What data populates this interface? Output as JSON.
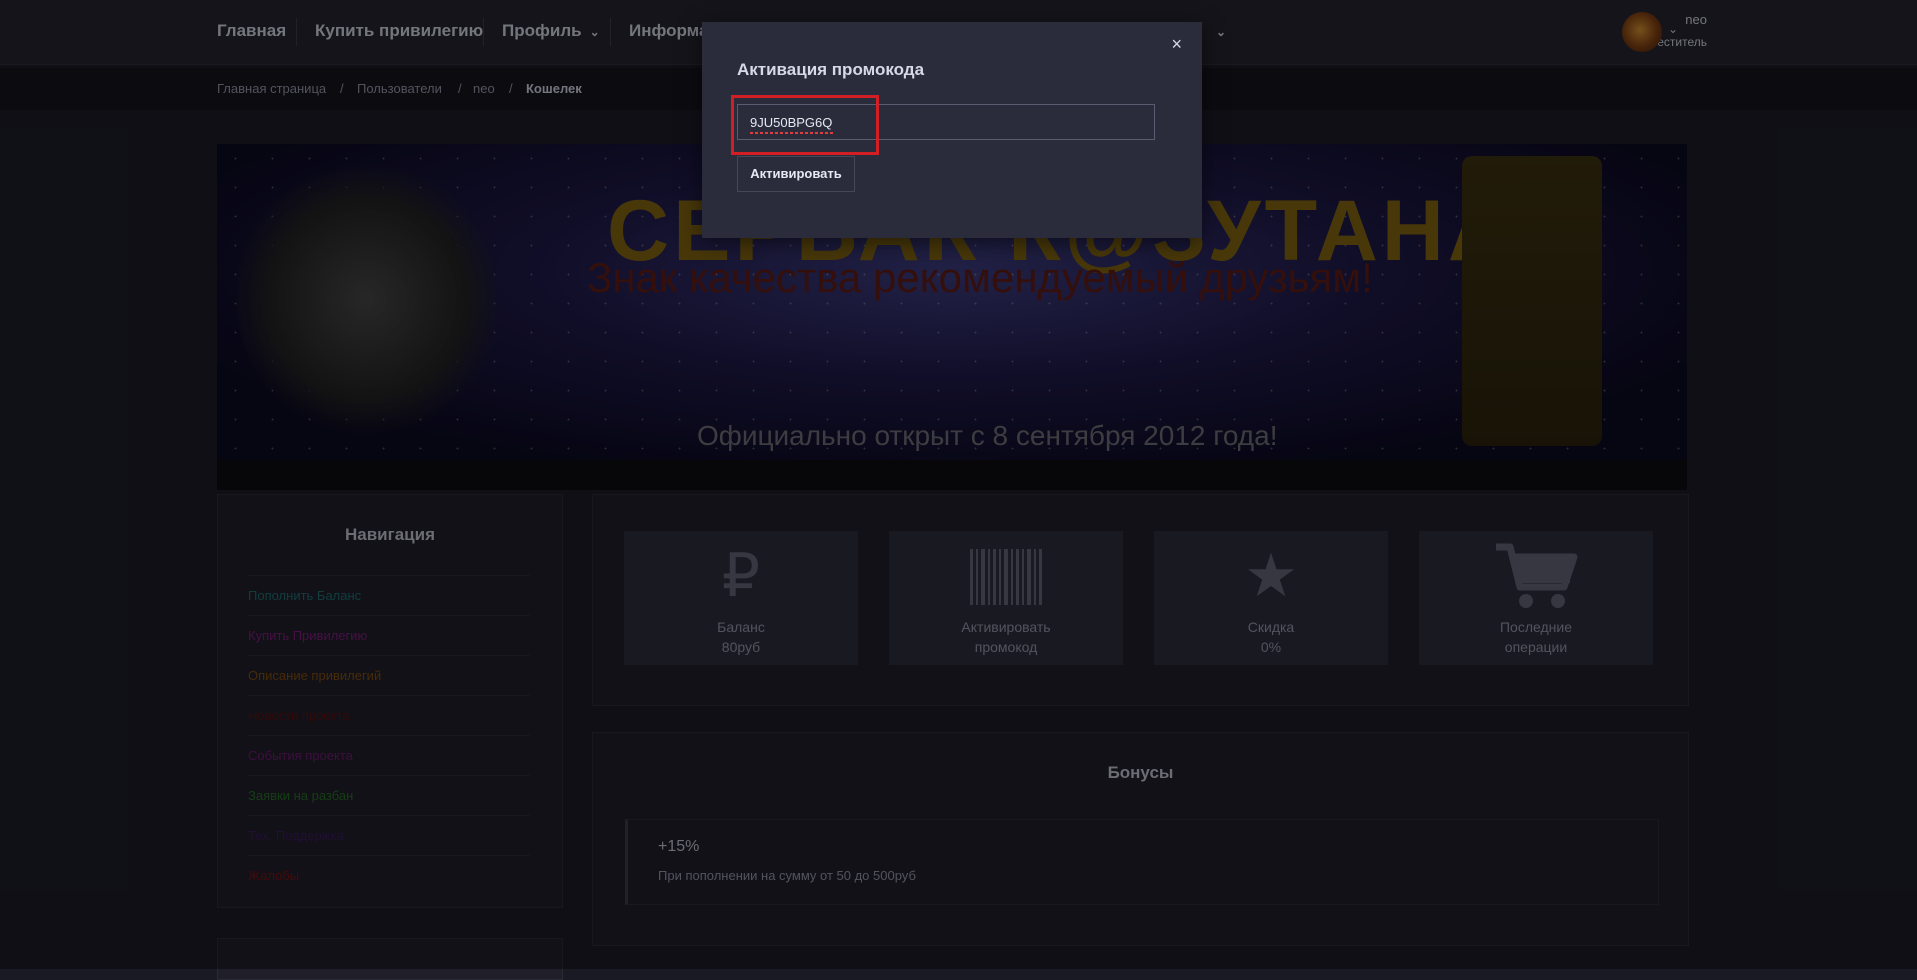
{
  "nav": {
    "items": [
      "Главная",
      "Купить привилегию",
      "Профиль",
      "Информа"
    ],
    "user": {
      "name": "neo",
      "role": "Заместитель"
    }
  },
  "breadcrumbs": [
    "Главная страница",
    "/",
    "Пользователи",
    "/",
    "neo",
    "/",
    "Кошелек"
  ],
  "banner": {
    "title": "СЕРВАК К@ЗУТАНА",
    "slogan": "Знак качества рекомендуемый друзьям!",
    "opened": "Официально открыт с 8 сентября 2012 года!"
  },
  "sidebar": {
    "title": "Навигация",
    "links": [
      {
        "label": "Пополнить Баланс",
        "color": "#1e6a6a"
      },
      {
        "label": "Купить Привилегию",
        "color": "#7a1c78"
      },
      {
        "label": "Описание привилегий",
        "color": "#7a4a0e"
      },
      {
        "label": "Новости проекта",
        "color": "#5a1010"
      },
      {
        "label": "События проекта",
        "color": "#6a1a6a"
      },
      {
        "label": "Заявки на разбан",
        "color": "#256a25"
      },
      {
        "label": "Тех. Поддержка",
        "color": "#3a1a5a"
      },
      {
        "label": "Жалобы",
        "color": "#7a1010"
      }
    ]
  },
  "cards": [
    {
      "icon": "ruble-icon",
      "line1": "Баланс",
      "line2": "80руб"
    },
    {
      "icon": "barcode-icon",
      "line1": "Активировать",
      "line2": "промокод"
    },
    {
      "icon": "star-icon",
      "line1": "Скидка",
      "line2": "0%"
    },
    {
      "icon": "cart-icon",
      "line1": "Последние",
      "line2": "операции"
    }
  ],
  "bonuses": {
    "title": "Бонусы",
    "items": [
      {
        "percent": "+15%",
        "desc": "При пополнении на сумму от 50 до 500руб"
      }
    ]
  },
  "modal": {
    "title": "Активация промокода",
    "close": "×",
    "code": "9JU50BPG6Q",
    "button": "Активировать"
  },
  "colors": {
    "highlight": "#d21f26"
  }
}
